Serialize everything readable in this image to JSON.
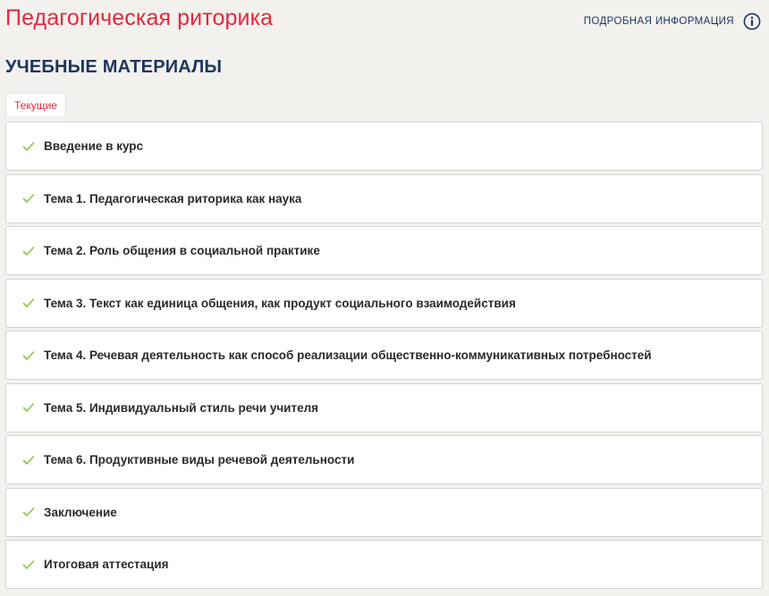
{
  "course": {
    "title": "Педагогическая риторика"
  },
  "info_link": {
    "label": "ПОДРОБНАЯ ИНФОРМАЦИЯ",
    "icon": "info-icon"
  },
  "section": {
    "title": "УЧЕБНЫЕ МАТЕРИАЛЫ"
  },
  "tabs": [
    {
      "label": "Текущие",
      "active": true
    }
  ],
  "materials": [
    {
      "label": "Введение в курс",
      "completed": true,
      "icon": "check-icon"
    },
    {
      "label": "Тема 1. Педагогическая риторика как наука",
      "completed": true,
      "icon": "check-icon"
    },
    {
      "label": "Тема 2. Роль общения в социальной практике",
      "completed": true,
      "icon": "check-icon"
    },
    {
      "label": "Тема 3. Текст как единица общения, как продукт социального взаимодействия",
      "completed": true,
      "icon": "check-icon"
    },
    {
      "label": "Тема 4. Речевая деятельность как способ реализации общественно-коммуникативных потребностей",
      "completed": true,
      "icon": "check-icon"
    },
    {
      "label": "Тема 5. Индивидуальный стиль речи учителя",
      "completed": true,
      "icon": "check-icon"
    },
    {
      "label": "Тема 6. Продуктивные виды речевой деятельности",
      "completed": true,
      "icon": "check-icon"
    },
    {
      "label": "Заключение",
      "completed": true,
      "icon": "check-icon"
    },
    {
      "label": "Итоговая аттестация",
      "completed": true,
      "icon": "check-icon"
    }
  ],
  "colors": {
    "accent_red": "#e5283c",
    "navy": "#1c355e",
    "check_green": "#8cc63f",
    "background": "#f3f1ee"
  }
}
